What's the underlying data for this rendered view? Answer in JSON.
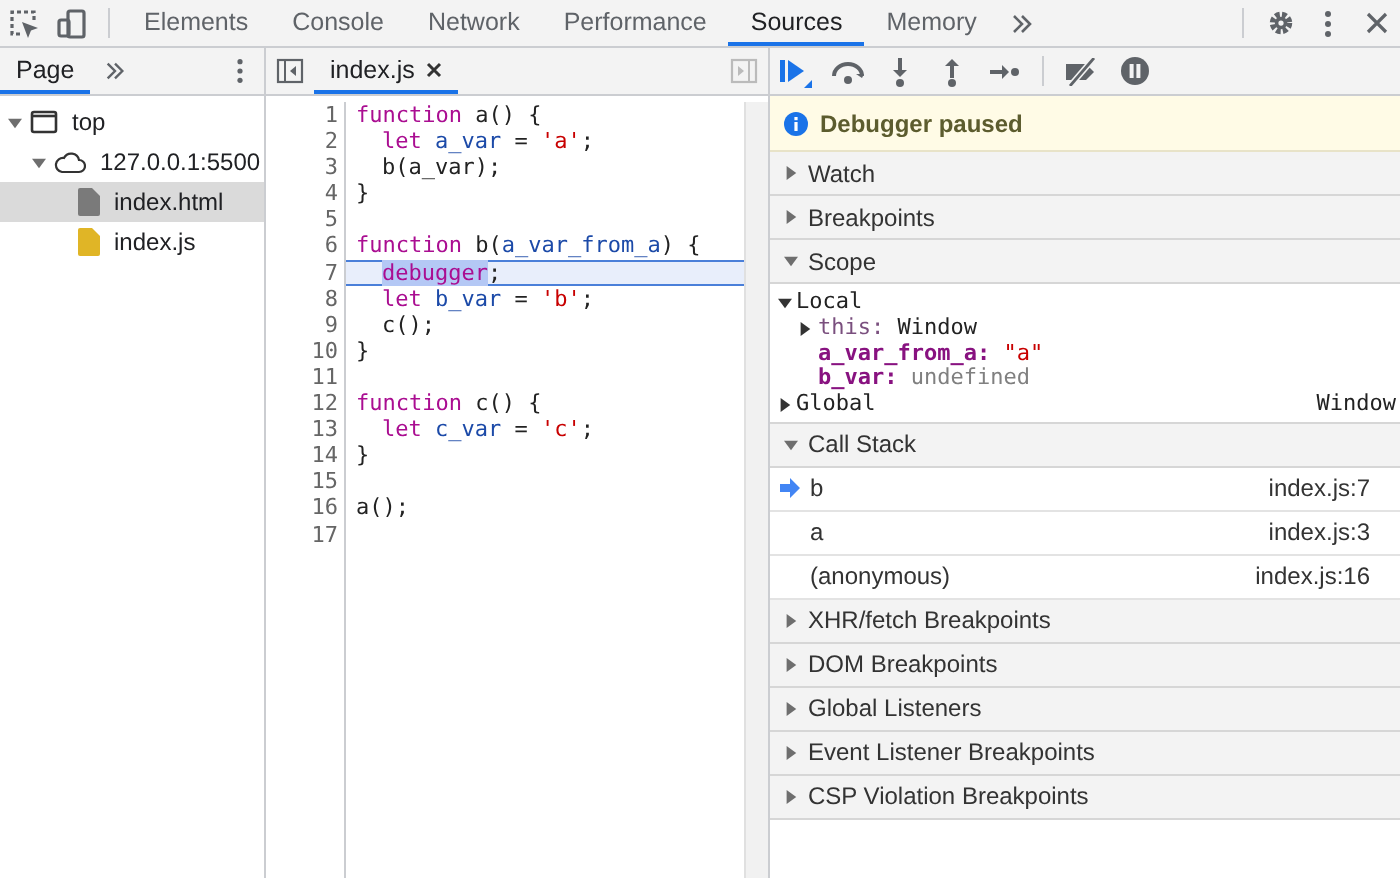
{
  "main_tabs": [
    {
      "label": "Elements",
      "selected": false
    },
    {
      "label": "Console",
      "selected": false
    },
    {
      "label": "Network",
      "selected": false
    },
    {
      "label": "Performance",
      "selected": false
    },
    {
      "label": "Sources",
      "selected": true
    },
    {
      "label": "Memory",
      "selected": false
    }
  ],
  "navigator": {
    "tab": "Page",
    "tree": [
      {
        "label": "top",
        "kind": "frame",
        "expanded": true,
        "children": [
          {
            "label": "127.0.0.1:5500",
            "kind": "origin",
            "expanded": true,
            "children": [
              {
                "label": "index.html",
                "kind": "html",
                "selected": true
              },
              {
                "label": "index.js",
                "kind": "js",
                "selected": false
              }
            ]
          }
        ]
      }
    ]
  },
  "editor": {
    "file_tab": "index.js",
    "lines": [
      {
        "number": "1",
        "current": false,
        "indented": false,
        "tokens": [
          {
            "text": "function",
            "kind": "keyword"
          },
          {
            "text": " a() {",
            "kind": "plain"
          }
        ]
      },
      {
        "number": "2",
        "current": false,
        "indented": true,
        "tokens": [
          {
            "text": "let",
            "kind": "keyword"
          },
          {
            "text": " a_var",
            "kind": "def"
          },
          {
            "text": " = ",
            "kind": "plain"
          },
          {
            "text": "'a'",
            "kind": "string"
          },
          {
            "text": ";",
            "kind": "plain"
          }
        ]
      },
      {
        "number": "3",
        "current": false,
        "indented": true,
        "tokens": [
          {
            "text": "b(a_var);",
            "kind": "plain"
          }
        ]
      },
      {
        "number": "4",
        "current": false,
        "indented": false,
        "tokens": [
          {
            "text": "}",
            "kind": "plain"
          }
        ]
      },
      {
        "number": "5"
      },
      {
        "number": "6",
        "current": false,
        "indented": false,
        "tokens": [
          {
            "text": "function",
            "kind": "keyword"
          },
          {
            "text": " b(",
            "kind": "plain"
          },
          {
            "text": "a_var_from_a",
            "kind": "def"
          },
          {
            "text": ") {",
            "kind": "plain"
          }
        ]
      },
      {
        "number": "7",
        "current": true,
        "indented": true,
        "tokens": [
          {
            "text": "debugger",
            "kind": "keyword",
            "selected": true
          },
          {
            "text": ";",
            "kind": "plain"
          }
        ]
      },
      {
        "number": "8",
        "current": false,
        "indented": true,
        "tokens": [
          {
            "text": "let",
            "kind": "keyword"
          },
          {
            "text": " b_var",
            "kind": "def"
          },
          {
            "text": " = ",
            "kind": "plain"
          },
          {
            "text": "'b'",
            "kind": "string"
          },
          {
            "text": ";",
            "kind": "plain"
          }
        ]
      },
      {
        "number": "9",
        "current": false,
        "indented": true,
        "tokens": [
          {
            "text": "c();",
            "kind": "plain"
          }
        ]
      },
      {
        "number": "10",
        "current": false,
        "indented": false,
        "tokens": [
          {
            "text": "}",
            "kind": "plain"
          }
        ]
      },
      {
        "number": "11"
      },
      {
        "number": "12",
        "current": false,
        "indented": false,
        "tokens": [
          {
            "text": "function",
            "kind": "keyword"
          },
          {
            "text": " c() {",
            "kind": "plain"
          }
        ]
      },
      {
        "number": "13",
        "current": false,
        "indented": true,
        "tokens": [
          {
            "text": "let",
            "kind": "keyword"
          },
          {
            "text": " c_var",
            "kind": "def"
          },
          {
            "text": " = ",
            "kind": "plain"
          },
          {
            "text": "'c'",
            "kind": "string"
          },
          {
            "text": ";",
            "kind": "plain"
          }
        ]
      },
      {
        "number": "14",
        "current": false,
        "indented": false,
        "tokens": [
          {
            "text": "}",
            "kind": "plain"
          }
        ]
      },
      {
        "number": "15"
      },
      {
        "number": "16",
        "current": false,
        "indented": false,
        "tokens": [
          {
            "text": "a();",
            "kind": "plain"
          }
        ]
      },
      {
        "number": "17"
      }
    ]
  },
  "debugger": {
    "banner": "Debugger paused",
    "sections": [
      {
        "title": "Watch",
        "expanded": false
      },
      {
        "title": "Breakpoints",
        "expanded": false
      },
      {
        "title": "Scope",
        "expanded": true,
        "scopes": [
          {
            "name": "Local",
            "expanded": true,
            "entries": [
              {
                "name": "this:",
                "value": "Window",
                "kind": "object",
                "expandable": true
              },
              {
                "name": "a_var_from_a:",
                "value": "\"a\"",
                "kind": "string",
                "expandable": false
              },
              {
                "name": "b_var:",
                "value": "undefined",
                "kind": "undefined",
                "expandable": false
              }
            ]
          },
          {
            "name": "Global",
            "expanded": false,
            "value": "Window"
          }
        ]
      },
      {
        "title": "Call Stack",
        "expanded": true,
        "frames": [
          {
            "name": "b",
            "location": "index.js:7",
            "selected": true
          },
          {
            "name": "a",
            "location": "index.js:3",
            "selected": false
          },
          {
            "name": "(anonymous)",
            "location": "index.js:16",
            "selected": false
          }
        ]
      },
      {
        "title": "XHR/fetch Breakpoints",
        "expanded": false
      },
      {
        "title": "DOM Breakpoints",
        "expanded": false
      },
      {
        "title": "Global Listeners",
        "expanded": false
      },
      {
        "title": "Event Listener Breakpoints",
        "expanded": false
      },
      {
        "title": "CSP Violation Breakpoints",
        "expanded": false
      }
    ]
  }
}
